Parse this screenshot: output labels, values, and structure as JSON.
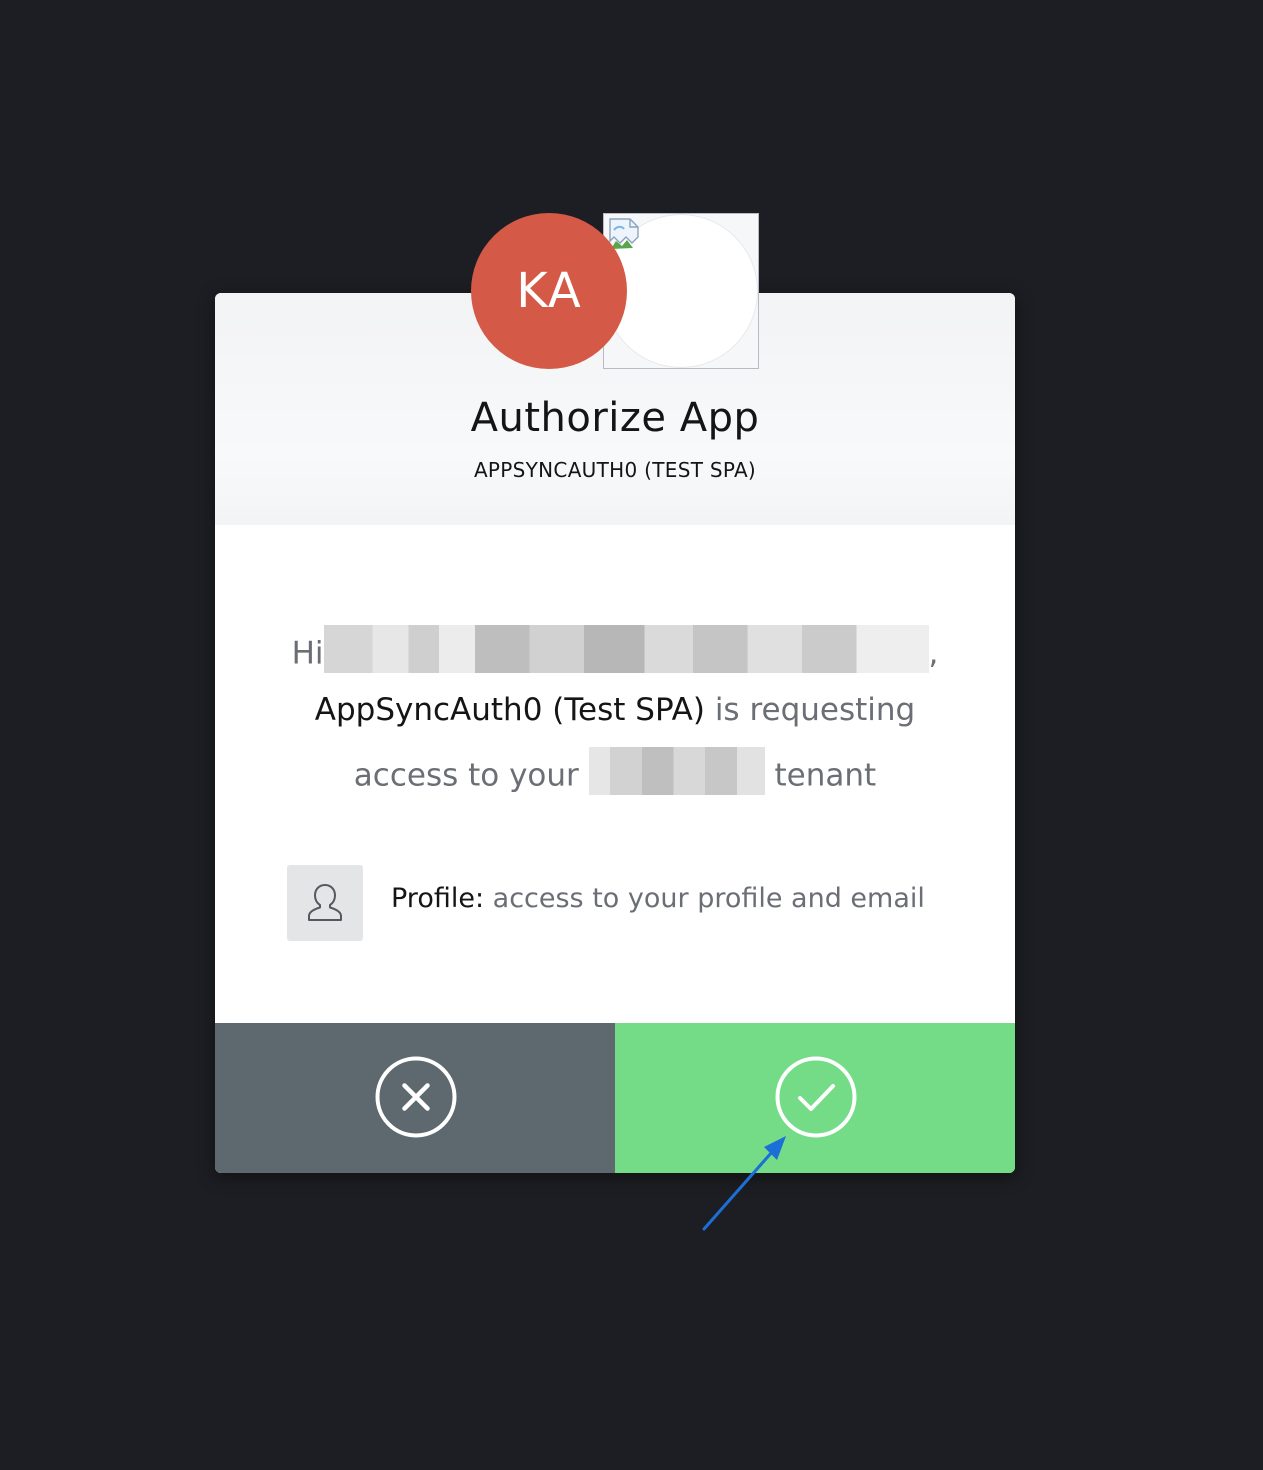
{
  "avatar": {
    "initials": "KA",
    "color": "#d45a47"
  },
  "app_logo": {
    "icon": "broken-image-icon"
  },
  "header": {
    "title": "Authorize App",
    "subtitle": "APPSYNCAUTH0 (TEST SPA)"
  },
  "message": {
    "greeting": "Hi",
    "greeting_suffix": ",",
    "app_name": "AppSyncAuth0 (Test SPA)",
    "requesting": " is requesting",
    "access_prefix": "access to your ",
    "tenant_suffix": " tenant"
  },
  "scopes": [
    {
      "icon": "user-profile-icon",
      "name": "Profile:",
      "description": " access to your profile and email"
    }
  ],
  "buttons": {
    "decline_icon": "x-circle-icon",
    "accept_icon": "check-circle-icon"
  },
  "colors": {
    "background": "#1d1e23",
    "decline": "#5e686f",
    "accept": "#74dc87",
    "annotation_arrow": "#1c6fd6"
  }
}
